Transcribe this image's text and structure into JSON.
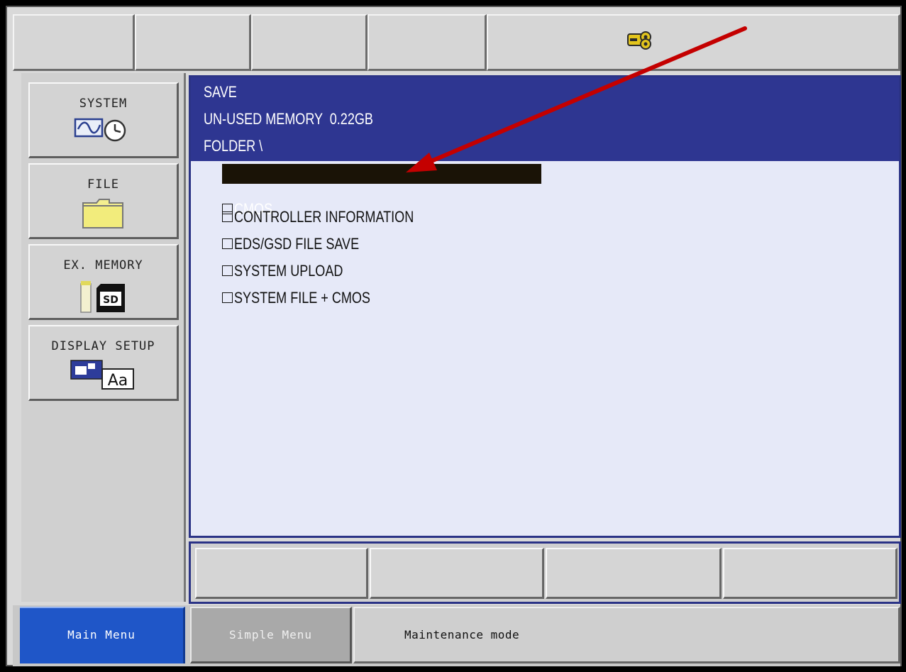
{
  "side_menu": {
    "items": [
      {
        "label": "SYSTEM",
        "icon": "waveform-clock-icon"
      },
      {
        "label": "FILE",
        "icon": "folder-icon"
      },
      {
        "label": "EX. MEMORY",
        "icon": "sd-card-icon"
      },
      {
        "label": "DISPLAY SETUP",
        "icon": "display-font-icon"
      }
    ]
  },
  "top_bar": {
    "icon": "key-icon"
  },
  "panel": {
    "title": "SAVE",
    "memory": "UN-USED MEMORY  0.22GB",
    "folder": "FOLDER \\",
    "items": [
      {
        "label": "CMOS",
        "selected": true
      },
      {
        "label": "CONTROLLER INFORMATION",
        "selected": false
      },
      {
        "label": "EDS/GSD FILE SAVE",
        "selected": false
      },
      {
        "label": "SYSTEM UPLOAD",
        "selected": false
      },
      {
        "label": "SYSTEM FILE + CMOS",
        "selected": false
      }
    ]
  },
  "bottom_bar": {
    "main_menu": "Main Menu",
    "simple_menu": "Simple Menu",
    "status": "Maintenance mode"
  },
  "colors": {
    "header_bg": "#2e3691",
    "list_bg": "#e6e9f8",
    "selection_bg": "#1a1306",
    "main_menu_bg": "#1f56c8",
    "annotation_arrow": "#c40000"
  }
}
